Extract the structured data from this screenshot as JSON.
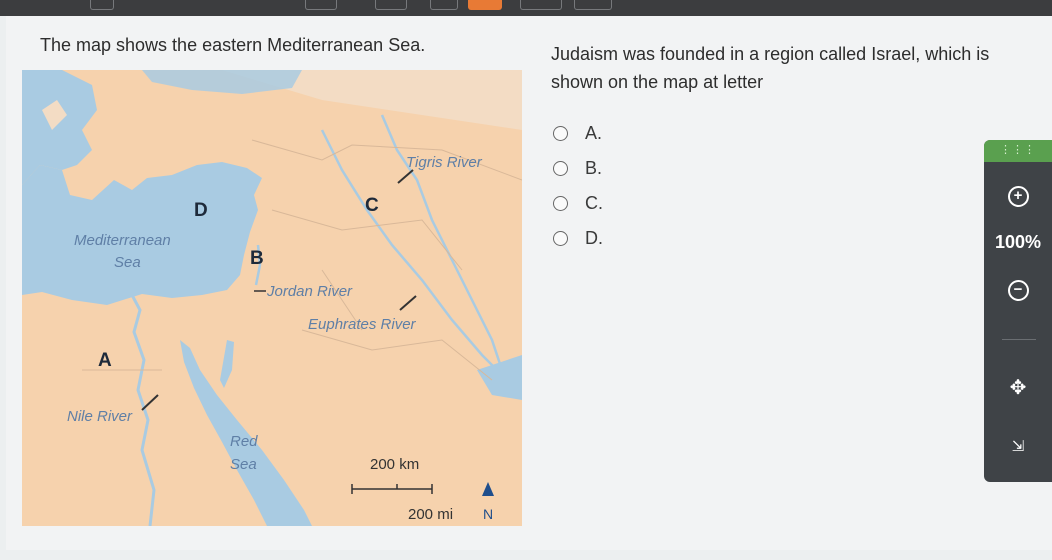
{
  "question": {
    "stem_left": "The map shows the eastern Mediterranean Sea.",
    "stem_right": "Judaism was founded in a region called Israel, which is shown on the map at letter"
  },
  "options": [
    {
      "label": "A."
    },
    {
      "label": "B."
    },
    {
      "label": "C."
    },
    {
      "label": "D."
    }
  ],
  "map": {
    "letters": {
      "a": "A",
      "b": "B",
      "c": "C",
      "d": "D"
    },
    "labels": {
      "mediterranean_line1": "Mediterranean",
      "mediterranean_line2": "Sea",
      "red_line1": "Red",
      "red_line2": "Sea",
      "tigris": "Tigris River",
      "jordan": "Jordan River",
      "euphrates": "Euphrates River",
      "nile": "Nile River"
    },
    "scale": {
      "km": "200 km",
      "mi": "200 mi"
    },
    "compass": "N",
    "colors": {
      "land": "#f6d2ad",
      "water": "#a9cbe2",
      "label": "#5f7fa6"
    }
  },
  "zoom": {
    "level": "100%",
    "grip_icon": "grip-icon",
    "zoom_in_icon": "plus-circle-icon",
    "zoom_out_icon": "minus-circle-icon",
    "pan_icon": "move-arrows-icon",
    "collapse_icon": "collapse-arrows-icon"
  }
}
